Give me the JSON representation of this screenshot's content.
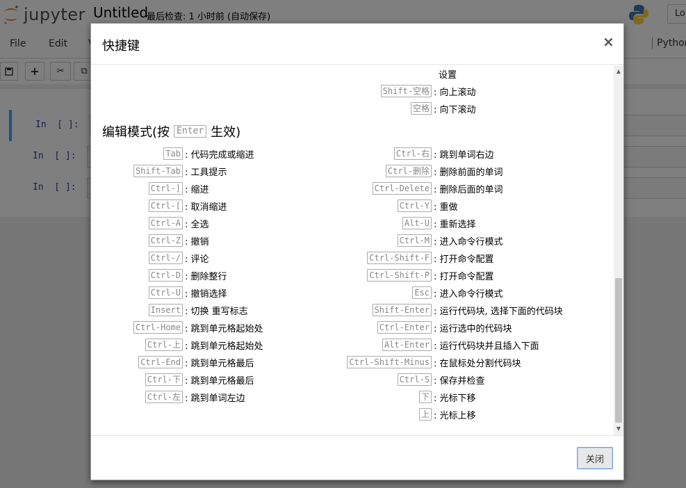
{
  "header": {
    "logo_text": "jupyter",
    "notebook_title": "Untitled",
    "checkpoint_status": "最后检查: 1 小时前 (自动保存)",
    "login_button": "Lo"
  },
  "menu": {
    "items": [
      "File",
      "Edit",
      "V"
    ],
    "kernel": "Python"
  },
  "cells": [
    {
      "prompt": "In  [ ]:"
    },
    {
      "prompt": "In  [ ]:"
    },
    {
      "prompt": "In  [ ]:"
    }
  ],
  "modal": {
    "title": "快捷键",
    "close_symbol": "×",
    "close_button": "关闭",
    "top_settings_text": "设置",
    "top_rows": [
      {
        "key": "Shift-空格",
        "desc": ": 向上滚动"
      },
      {
        "key": "空格",
        "desc": ": 向下滚动"
      }
    ],
    "section": {
      "title_prefix": "编辑模式(按",
      "title_key": "Enter",
      "title_suffix": "生效)"
    },
    "left_shortcuts": [
      {
        "key": "Tab",
        "desc": ": 代码完成或缩进"
      },
      {
        "key": "Shift-Tab",
        "desc": ": 工具提示"
      },
      {
        "key": "Ctrl-]",
        "desc": ": 缩进"
      },
      {
        "key": "Ctrl-[",
        "desc": ": 取消缩进"
      },
      {
        "key": "Ctrl-A",
        "desc": ": 全选"
      },
      {
        "key": "Ctrl-Z",
        "desc": ": 撤销"
      },
      {
        "key": "Ctrl-/",
        "desc": ": 评论"
      },
      {
        "key": "Ctrl-D",
        "desc": ": 删除整行"
      },
      {
        "key": "Ctrl-U",
        "desc": ": 撤销选择"
      },
      {
        "key": "Insert",
        "desc": ": 切换 重写标志"
      },
      {
        "key": "Ctrl-Home",
        "desc": ": 跳到单元格起始处"
      },
      {
        "key": "Ctrl-上",
        "desc": ": 跳到单元格起始处"
      },
      {
        "key": "Ctrl-End",
        "desc": ": 跳到单元格最后"
      },
      {
        "key": "Ctrl-下",
        "desc": ": 跳到单元格最后"
      },
      {
        "key": "Ctrl-左",
        "desc": ": 跳到单词左边"
      }
    ],
    "right_shortcuts": [
      {
        "key": "Ctrl-右",
        "desc": ": 跳到单词右边"
      },
      {
        "key": "Ctrl-删除",
        "desc": ": 删除前面的单词"
      },
      {
        "key": "Ctrl-Delete",
        "desc": ": 删除后面的单词"
      },
      {
        "key": "Ctrl-Y",
        "desc": ": 重做"
      },
      {
        "key": "Alt-U",
        "desc": ": 重新选择"
      },
      {
        "key": "Ctrl-M",
        "desc": ": 进入命令行模式"
      },
      {
        "key": "Ctrl-Shift-F",
        "desc": ": 打开命令配置"
      },
      {
        "key": "Ctrl-Shift-P",
        "desc": ": 打开命令配置"
      },
      {
        "key": "Esc",
        "desc": ": 进入命令行模式"
      },
      {
        "key": "Shift-Enter",
        "desc": ": 运行代码块, 选择下面的代码块"
      },
      {
        "key": "Ctrl-Enter",
        "desc": ": 运行选中的代码块"
      },
      {
        "key": "Alt-Enter",
        "desc": ": 运行代码块并且插入下面"
      },
      {
        "key": "Ctrl-Shift-Minus",
        "desc": ": 在鼠标处分割代码块"
      },
      {
        "key": "Ctrl-S",
        "desc": ": 保存并检查"
      },
      {
        "key": "下",
        "desc": ": 光标下移"
      },
      {
        "key": "上",
        "desc": ": 光标上移"
      }
    ]
  },
  "colors": {
    "selected_cell_border": "#42a5f5",
    "prompt": "#303f9f",
    "backdrop": "#000000"
  }
}
